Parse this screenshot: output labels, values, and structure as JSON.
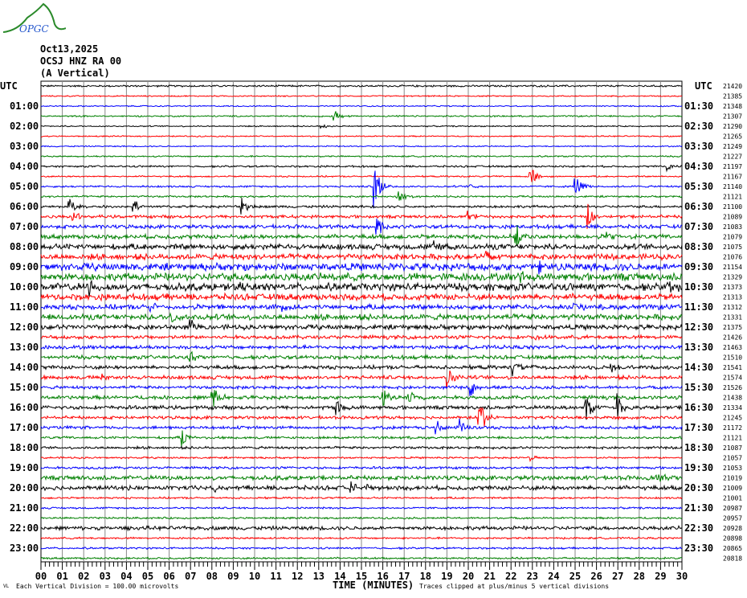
{
  "header": {
    "logo_text": "OPGC",
    "date": "Oct13,2025",
    "station": "OCSJ HNZ RA 00",
    "component": "(A Vertical)"
  },
  "chart_data": {
    "type": "line",
    "title": "OCSJ HNZ RA 00 helicorder",
    "xlabel": "TIME (MINUTES)",
    "xlim": [
      0,
      30
    ],
    "x_ticks": [
      "00",
      "01",
      "02",
      "03",
      "04",
      "05",
      "06",
      "07",
      "08",
      "09",
      "10",
      "11",
      "12",
      "13",
      "14",
      "15",
      "16",
      "17",
      "18",
      "19",
      "20",
      "21",
      "22",
      "23",
      "24",
      "25",
      "26",
      "27",
      "28",
      "29",
      "30"
    ],
    "left_axis_title": "UTC",
    "right_axis_title": "UTC",
    "left_labels": [
      "01:00",
      "02:00",
      "03:00",
      "04:00",
      "05:00",
      "06:00",
      "07:00",
      "08:00",
      "09:00",
      "10:00",
      "11:00",
      "12:00",
      "13:00",
      "14:00",
      "15:00",
      "16:00",
      "17:00",
      "18:00",
      "19:00",
      "20:00",
      "21:00",
      "22:00",
      "23:00"
    ],
    "right_labels": [
      "01:30",
      "02:30",
      "03:30",
      "04:30",
      "05:30",
      "06:30",
      "07:30",
      "08:30",
      "09:30",
      "10:30",
      "11:30",
      "12:30",
      "13:30",
      "14:30",
      "15:30",
      "16:30",
      "17:30",
      "18:30",
      "19:30",
      "20:30",
      "21:30",
      "22:30",
      "23:30"
    ],
    "right_values": [
      "21420",
      "21385",
      "21348",
      "21307",
      "21290",
      "21265",
      "21249",
      "21227",
      "21197",
      "21167",
      "21140",
      "21121",
      "21100",
      "21089",
      "21083",
      "21079",
      "21075",
      "21076",
      "21154",
      "21329",
      "21373",
      "21313",
      "21312",
      "21331",
      "21375",
      "21426",
      "21463",
      "21510",
      "21541",
      "21574",
      "21526",
      "21438",
      "21334",
      "21245",
      "21172",
      "21121",
      "21087",
      "21057",
      "21053",
      "21019",
      "21009",
      "21001",
      "20987",
      "20957",
      "20928",
      "20898",
      "20865",
      "20818"
    ],
    "trace_colors": [
      "#000000",
      "#ff0000",
      "#0000ff",
      "#008000"
    ],
    "row_noise_divisions": [
      0.15,
      0.1,
      0.1,
      0.12,
      0.1,
      0.1,
      0.1,
      0.12,
      0.15,
      0.12,
      0.15,
      0.15,
      0.2,
      0.25,
      0.3,
      0.35,
      0.45,
      0.45,
      0.6,
      0.6,
      0.6,
      0.5,
      0.4,
      0.45,
      0.4,
      0.3,
      0.3,
      0.3,
      0.3,
      0.3,
      0.25,
      0.3,
      0.3,
      0.25,
      0.25,
      0.2,
      0.2,
      0.15,
      0.2,
      0.35,
      0.35,
      0.15,
      0.15,
      0.15,
      0.3,
      0.15,
      0.15,
      0.15
    ],
    "events": [
      {
        "row": 3,
        "minute": 13.7,
        "amp": 1.5
      },
      {
        "row": 4,
        "minute": 13.1,
        "amp": 0.6
      },
      {
        "row": 8,
        "minute": 29.3,
        "amp": 1.2
      },
      {
        "row": 9,
        "minute": 22.9,
        "amp": 2.5
      },
      {
        "row": 10,
        "minute": 15.6,
        "amp": 5
      },
      {
        "row": 10,
        "minute": 25.0,
        "amp": 3
      },
      {
        "row": 10,
        "minute": 20.1,
        "amp": 0.8
      },
      {
        "row": 11,
        "minute": 16.7,
        "amp": 2
      },
      {
        "row": 12,
        "minute": 1.3,
        "amp": 2.5
      },
      {
        "row": 12,
        "minute": 4.3,
        "amp": 2
      },
      {
        "row": 12,
        "minute": 9.4,
        "amp": 2
      },
      {
        "row": 13,
        "minute": 1.5,
        "amp": 1.5
      },
      {
        "row": 13,
        "minute": 25.6,
        "amp": 2.5
      },
      {
        "row": 13,
        "minute": 20.0,
        "amp": 1.5
      },
      {
        "row": 14,
        "minute": 15.7,
        "amp": 3.5
      },
      {
        "row": 15,
        "minute": 22.2,
        "amp": 3
      },
      {
        "row": 15,
        "minute": 26.5,
        "amp": 1.5
      },
      {
        "row": 16,
        "minute": 18.4,
        "amp": 1.5
      },
      {
        "row": 17,
        "minute": 20.8,
        "amp": 1.5
      },
      {
        "row": 18,
        "minute": 23.3,
        "amp": 1.5
      },
      {
        "row": 19,
        "minute": 22.4,
        "amp": 3
      },
      {
        "row": 20,
        "minute": 2.3,
        "amp": 2
      },
      {
        "row": 20,
        "minute": 9.1,
        "amp": 1.5
      },
      {
        "row": 20,
        "minute": 29.3,
        "amp": 1.5
      },
      {
        "row": 22,
        "minute": 5.1,
        "amp": 1.5
      },
      {
        "row": 22,
        "minute": 11.3,
        "amp": 1.5
      },
      {
        "row": 22,
        "minute": 24.9,
        "amp": 1.5
      },
      {
        "row": 23,
        "minute": 6.1,
        "amp": 1
      },
      {
        "row": 24,
        "minute": 7.0,
        "amp": 1.5
      },
      {
        "row": 25,
        "minute": 23.0,
        "amp": 1
      },
      {
        "row": 27,
        "minute": 7.0,
        "amp": 1
      },
      {
        "row": 28,
        "minute": 22.1,
        "amp": 2.5
      },
      {
        "row": 28,
        "minute": 26.7,
        "amp": 1
      },
      {
        "row": 29,
        "minute": 19.0,
        "amp": 2.5
      },
      {
        "row": 29,
        "minute": 2.8,
        "amp": 1
      },
      {
        "row": 30,
        "minute": 20.1,
        "amp": 2
      },
      {
        "row": 31,
        "minute": 8.0,
        "amp": 4
      },
      {
        "row": 31,
        "minute": 16.0,
        "amp": 3
      },
      {
        "row": 31,
        "minute": 17.2,
        "amp": 2
      },
      {
        "row": 32,
        "minute": 13.8,
        "amp": 3
      },
      {
        "row": 32,
        "minute": 25.5,
        "amp": 3.5
      },
      {
        "row": 32,
        "minute": 27.0,
        "amp": 3
      },
      {
        "row": 33,
        "minute": 20.5,
        "amp": 5
      },
      {
        "row": 34,
        "minute": 18.5,
        "amp": 2
      },
      {
        "row": 34,
        "minute": 19.6,
        "amp": 2
      },
      {
        "row": 35,
        "minute": 6.6,
        "amp": 2
      },
      {
        "row": 37,
        "minute": 22.9,
        "amp": 1
      },
      {
        "row": 39,
        "minute": 28.8,
        "amp": 1.2
      },
      {
        "row": 40,
        "minute": 14.5,
        "amp": 1.5
      },
      {
        "row": 40,
        "minute": 15.3,
        "amp": 1.2
      },
      {
        "row": 40,
        "minute": 8.1,
        "amp": 1
      }
    ]
  },
  "footer": {
    "vertical_division": "Each Vertical Division =  100.00 microvolts",
    "clipped_note": "Traces clipped at plus/minus 5 vertical divisions",
    "corner_mark": "VL"
  }
}
